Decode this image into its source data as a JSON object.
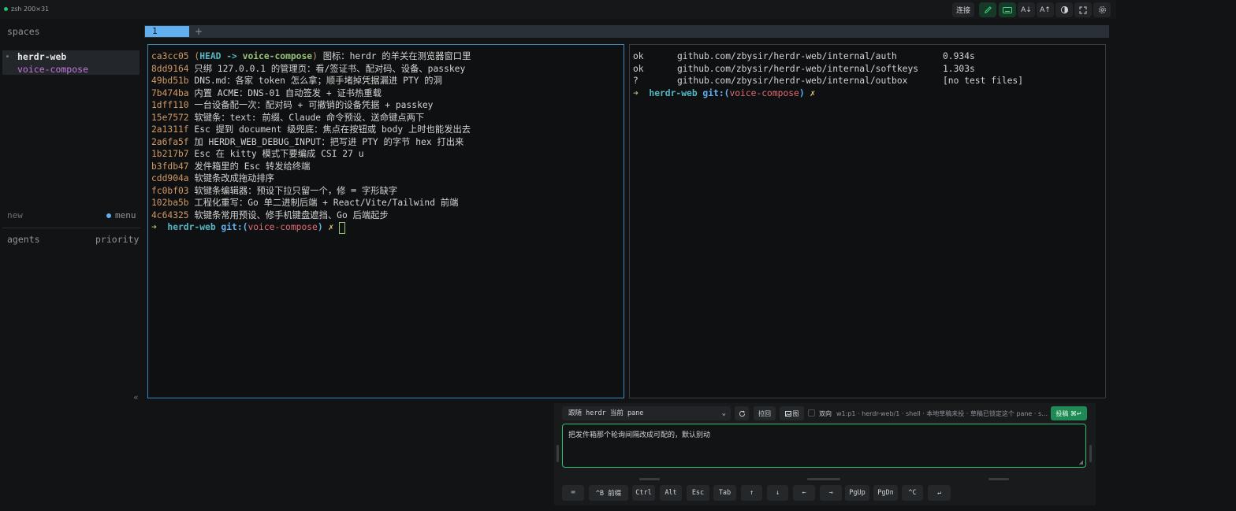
{
  "topbar": {
    "session": "zsh 200×31",
    "connect": "连接",
    "text_smaller": "A↓",
    "text_larger": "A↑"
  },
  "sidebar": {
    "spaces_label": "spaces",
    "space_name": "herdr-web",
    "space_branch": "voice-compose",
    "new_label": "new",
    "menu_label": "menu",
    "agents_label": "agents",
    "priority_label": "priority",
    "collapse": "«"
  },
  "tabs": [
    {
      "label": "1"
    }
  ],
  "tab_add": "+",
  "left_pane": {
    "log": [
      {
        "hash": "ca3cc05",
        "msg": " 图标：herdr 的羊关在测览器窗口里"
      },
      {
        "hash": "8dd9164",
        "msg": " 只绑 127.0.0.1 的管理页：看/签证书、配对码、设备、passkey"
      },
      {
        "hash": "49bd51b",
        "msg": " DNS.md：各家 token 怎么拿；顺手堵掉凭据漏进 PTY 的洞"
      },
      {
        "hash": "7b474ba",
        "msg": " 内置 ACME：DNS-01 自动签发 + 证书热重载"
      },
      {
        "hash": "1dff110",
        "msg": " 一台设备配一次：配对码 + 可撤销的设备凭据 + passkey"
      },
      {
        "hash": "15e7572",
        "msg": " 软键条：text: 前缀、Claude 命令预设、送命键点两下"
      },
      {
        "hash": "2a1311f",
        "msg": " Esc 提到 document 级兜底：焦点在按钮或 body 上时也能发出去"
      },
      {
        "hash": "2a6fa5f",
        "msg": " 加 HERDR_WEB_DEBUG_INPUT：把写进 PTY 的字节 hex 打出来"
      },
      {
        "hash": "1b217b7",
        "msg": " Esc 在 kitty 模式下要编成 CSI 27 u"
      },
      {
        "hash": "b3fdb47",
        "msg": " 发件箱里的 Esc 转发给终端"
      },
      {
        "hash": "cdd904a",
        "msg": " 软键条改成拖动排序"
      },
      {
        "hash": "fc0bf03",
        "msg": " 软键条编辑器：预设下拉只留一个，修 ⌨ 字形缺字"
      },
      {
        "hash": "102ba5b",
        "msg": " 工程化重写：Go 单二进制后端 + React/Vite/Tailwind 前端"
      },
      {
        "hash": "4c64325",
        "msg": " 软键条常用预设、修手机键盘遮挡、Go 后端起步"
      }
    ],
    "head_ref": "HEAD -> voice-compose",
    "prompt": {
      "arrow": "➜",
      "dir": "herdr-web",
      "git": "git:(",
      "branch": "voice-compose",
      "close": ")",
      "dirty": "✗"
    }
  },
  "right_pane": {
    "tests": [
      {
        "status": "ok",
        "pkg": "github.com/zbysir/herdr-web/internal/auth",
        "result": "0.934s"
      },
      {
        "status": "ok",
        "pkg": "github.com/zbysir/herdr-web/internal/softkeys",
        "result": "1.303s"
      },
      {
        "status": "?",
        "pkg": "github.com/zbysir/herdr-web/internal/outbox",
        "result": "[no test files]"
      }
    ],
    "prompt": {
      "arrow": "➜",
      "dir": "herdr-web",
      "git": "git:(",
      "branch": "voice-compose",
      "close": ")",
      "dirty": "✗"
    }
  },
  "compose": {
    "target": "跟随 herdr 当前 pane",
    "pull_back": "拉回",
    "image": "图",
    "duplex": "双向",
    "status": "w1:p1 · herdr-web/1 · shell · 本地草稿未投 · 草稿已锁定这个 pane · s…",
    "submit": "投稿 ⌘↵",
    "draft": "把发件箱那个轮询间隔改成可配的，默认别动"
  },
  "softkeys": [
    "⌨",
    "^B 前缀",
    "Ctrl",
    "Alt",
    "Esc",
    "Tab",
    "↑",
    "↓",
    "←",
    "→",
    "PgUp",
    "PgDn",
    "^C",
    "↵"
  ]
}
